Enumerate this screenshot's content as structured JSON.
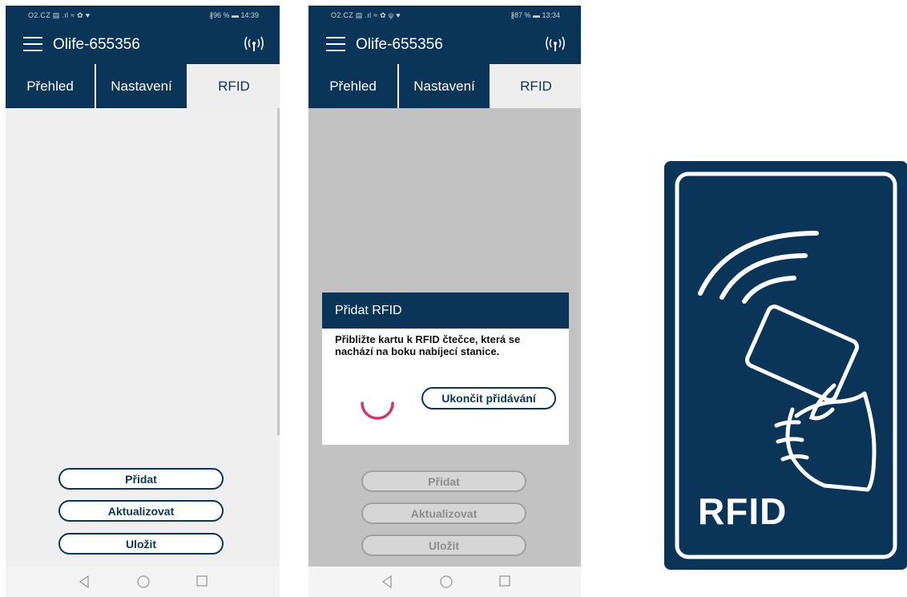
{
  "phone1": {
    "statusbar": {
      "left": "O2.CZ ▤ .ıl ≈ ✿ ♥",
      "right": "∦96 % ▬ 14:39"
    },
    "app_title": "Olife-655356",
    "tabs": [
      "Přehled",
      "Nastavení",
      "RFID"
    ],
    "active_tab": "RFID",
    "buttons": {
      "add": "Přidat",
      "update": "Aktualizovat",
      "save": "Uložit"
    },
    "nav": {
      "back": "◁",
      "home": "○",
      "recent": "□"
    }
  },
  "phone2": {
    "statusbar": {
      "left": "O2.CZ ▤ .ıl ≈ ✿ ψ ♥",
      "right": "∦87 % ▬ 13:34"
    },
    "app_title": "Olife-655356",
    "tabs": [
      "Přehled",
      "Nastavení",
      "RFID"
    ],
    "active_tab": "RFID",
    "dialog": {
      "title": "Přidat RFID",
      "message": "Přibližte kartu k RFID čtečce, která se nachází na boku nabíjecí stanice.",
      "stop_button": "Ukončit přidávání"
    },
    "buttons": {
      "add": "Přidat",
      "update": "Aktualizovat",
      "save": "Uložit"
    },
    "nav": {
      "back": "◁",
      "home": "○",
      "recent": "□"
    }
  },
  "rfid_card": {
    "label": "RFID"
  },
  "colors": {
    "brand": "#0b3558",
    "spinner": "#d6336c",
    "background": "#efefef"
  },
  "icons": [
    "menu-icon",
    "wireless-signal-icon",
    "rfid-hand-card-icon",
    "back-icon",
    "home-icon",
    "recent-apps-icon",
    "loading-spinner-icon"
  ]
}
